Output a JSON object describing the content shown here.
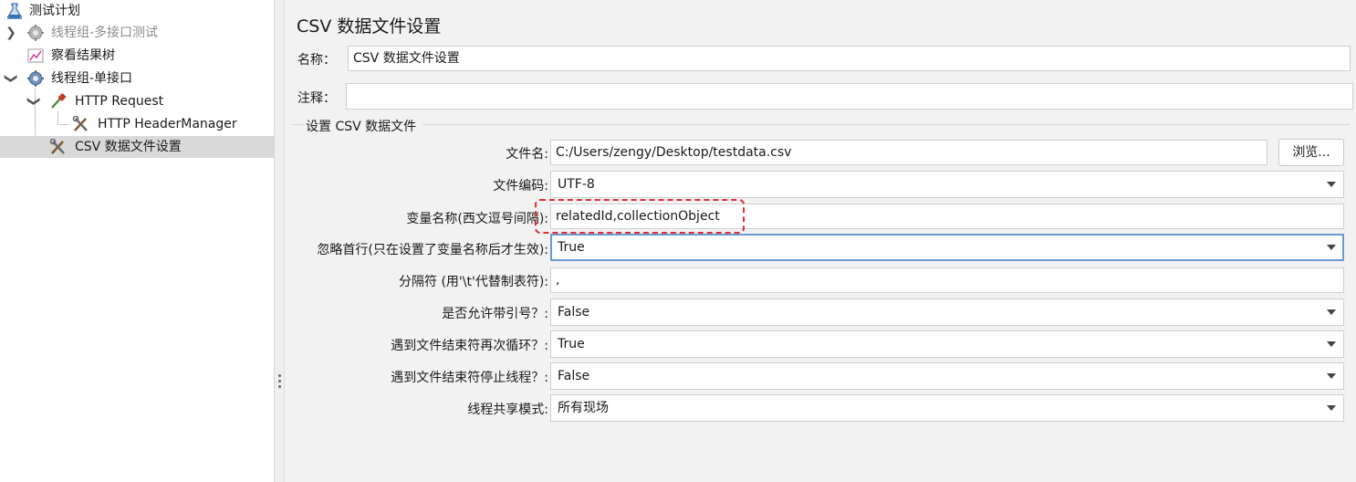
{
  "tree": {
    "items": [
      {
        "label": "测试计划",
        "icon": "flask-icon"
      },
      {
        "label": "线程组-多接口测试",
        "icon": "gear-icon",
        "disabled": true
      },
      {
        "label": "察看结果树",
        "icon": "chart-icon"
      },
      {
        "label": "线程组-单接口",
        "icon": "gear-icon"
      },
      {
        "label": "HTTP Request",
        "icon": "pipette-icon"
      },
      {
        "label": "HTTP HeaderManager",
        "icon": "tools-icon"
      },
      {
        "label": "CSV 数据文件设置",
        "icon": "tools-icon",
        "selected": true
      }
    ]
  },
  "panel": {
    "title": "CSV 数据文件设置",
    "name_label": "名称：",
    "name_value": "CSV 数据文件设置",
    "comment_label": "注释：",
    "comment_value": "",
    "section_title": "设置 CSV 数据文件",
    "filename_label": "文件名:",
    "filename_value": "C:/Users/zengy/Desktop/testdata.csv",
    "browse_label": "浏览...",
    "encoding_label": "文件编码:",
    "encoding_value": "UTF-8",
    "varnames_label": "变量名称(西文逗号间隔):",
    "varnames_value": "relatedId,collectionObject",
    "ignore_first_label": "忽略首行(只在设置了变量名称后才生效):",
    "ignore_first_value": "True",
    "delimiter_label": "分隔符 (用'\\t'代替制表符):",
    "delimiter_value": ",",
    "quoted_label": "是否允许带引号？:",
    "quoted_value": "False",
    "recycle_label": "遇到文件结束符再次循环？:",
    "recycle_value": "True",
    "stop_thread_label": "遇到文件结束符停止线程？:",
    "stop_thread_value": "False",
    "sharing_label": "线程共享模式:",
    "sharing_value": "所有现场"
  },
  "colors": {
    "highlight": "#e0303a",
    "focus": "#6b9bd3",
    "selected_row": "#d9d9d9"
  }
}
